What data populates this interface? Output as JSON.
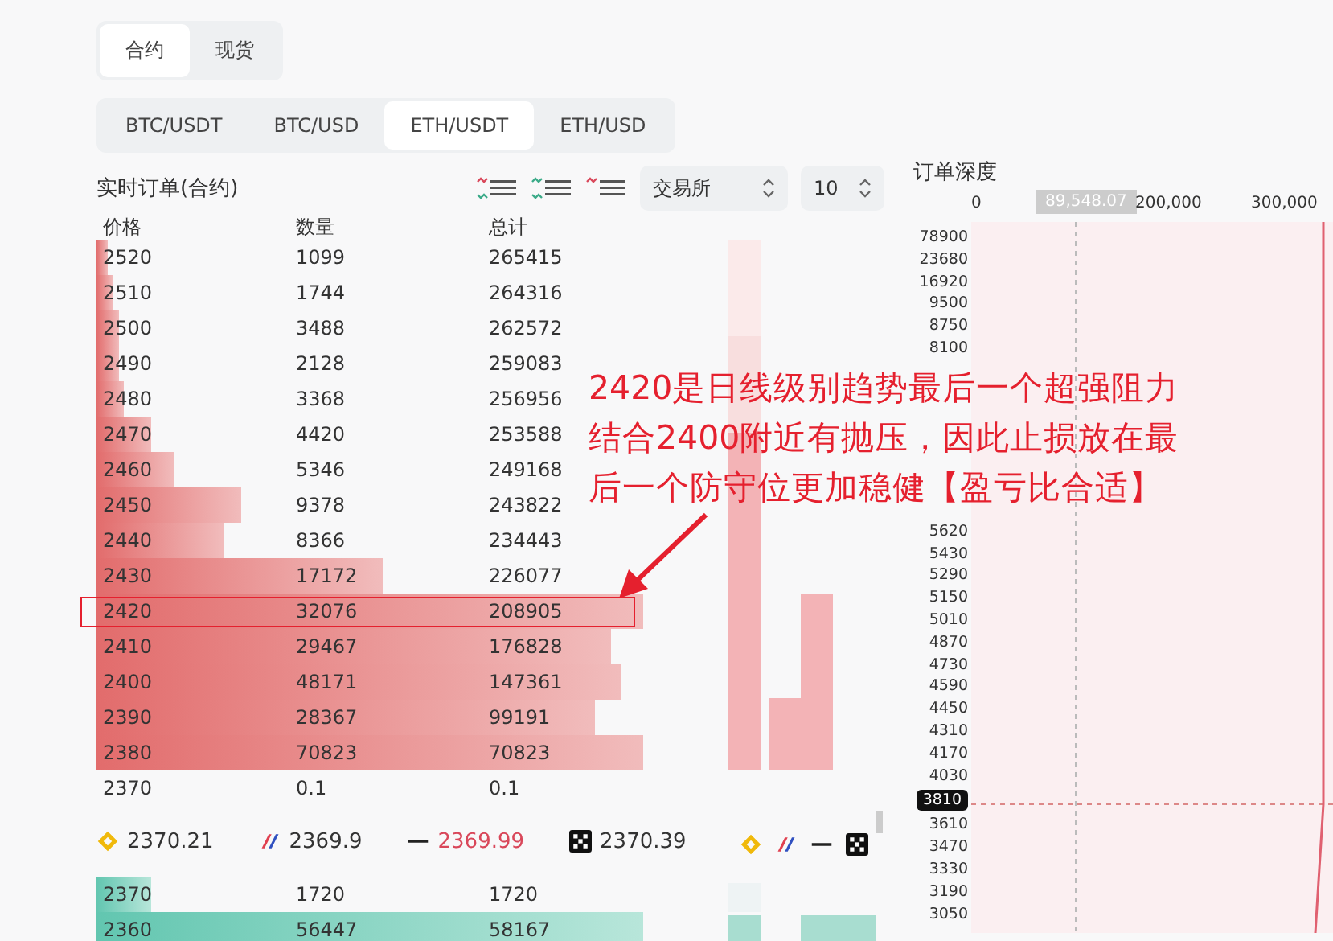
{
  "market_tabs": [
    {
      "label": "合约",
      "selected": true
    },
    {
      "label": "现货",
      "selected": false
    }
  ],
  "pair_tabs": [
    {
      "label": "BTC/USDT",
      "selected": false
    },
    {
      "label": "BTC/USD",
      "selected": false
    },
    {
      "label": "ETH/USDT",
      "selected": true
    },
    {
      "label": "ETH/USD",
      "selected": false
    }
  ],
  "order_book": {
    "title": "实时订单(合约)",
    "exchange_select": "交易所",
    "depth_select": "10",
    "columns": [
      "价格",
      "数量",
      "总计"
    ],
    "asks": [
      {
        "price": "2520",
        "amount": "1099",
        "total": "265415"
      },
      {
        "price": "2510",
        "amount": "1744",
        "total": "264316"
      },
      {
        "price": "2500",
        "amount": "3488",
        "total": "262572"
      },
      {
        "price": "2490",
        "amount": "2128",
        "total": "259083"
      },
      {
        "price": "2480",
        "amount": "3368",
        "total": "256956"
      },
      {
        "price": "2470",
        "amount": "4420",
        "total": "253588"
      },
      {
        "price": "2460",
        "amount": "5346",
        "total": "249168"
      },
      {
        "price": "2450",
        "amount": "9378",
        "total": "243822"
      },
      {
        "price": "2440",
        "amount": "8366",
        "total": "234443"
      },
      {
        "price": "2430",
        "amount": "17172",
        "total": "226077"
      },
      {
        "price": "2420",
        "amount": "32076",
        "total": "208905"
      },
      {
        "price": "2410",
        "amount": "29467",
        "total": "176828"
      },
      {
        "price": "2400",
        "amount": "48171",
        "total": "147361"
      },
      {
        "price": "2390",
        "amount": "28367",
        "total": "99191"
      },
      {
        "price": "2380",
        "amount": "70823",
        "total": "70823"
      }
    ],
    "spread_row": {
      "price": "2370",
      "amount": "0.1",
      "total": "0.1"
    },
    "exchange_prices": [
      {
        "price": "2370.21",
        "color": "#333333"
      },
      {
        "price": "2369.9",
        "color": "#333333"
      },
      {
        "price": "2369.99",
        "color": "#d9475a"
      },
      {
        "price": "2370.39",
        "color": "#333333"
      }
    ],
    "bids": [
      {
        "price": "2370",
        "amount": "1720",
        "total": "1720"
      },
      {
        "price": "2360",
        "amount": "56447",
        "total": "58167"
      }
    ]
  },
  "depth_chart": {
    "title": "订单深度",
    "x_ticks": [
      "0",
      "200,000",
      "300,000"
    ],
    "marker_label": "89,548.07",
    "upper_y_ticks": [
      "78900",
      "23680",
      "16920",
      "9500",
      "8750",
      "8100"
    ],
    "lower_y_ticks": [
      "5620",
      "5430",
      "5290",
      "5150",
      "5010",
      "4870",
      "4730",
      "4590",
      "4450",
      "4310",
      "4170",
      "4030"
    ],
    "current_price": "3810",
    "bottom_y_ticks": [
      "3610",
      "3470",
      "3330",
      "3190",
      "3050"
    ]
  },
  "annotation": {
    "lines": [
      "2420是日线级别趋势最后一个超强阻力",
      "结合2400附近有抛压，因此止损放在最",
      "后一个防守位更加稳健【盈亏比合适】"
    ]
  }
}
